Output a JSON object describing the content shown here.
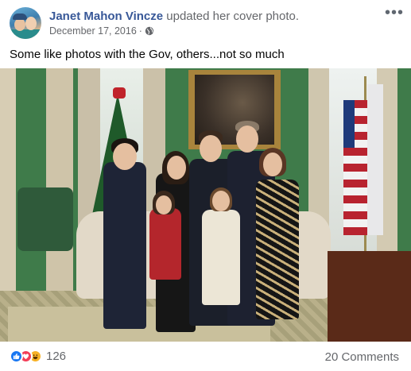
{
  "post": {
    "author": "Janet Mahon Vincze",
    "action": " updated her cover photo.",
    "date": "December 17, 2016",
    "dot": "·",
    "privacy_icon": "globe-icon",
    "more_label": "•••",
    "text": "Some like photos with the Gov, others...not so much"
  },
  "footer": {
    "reaction_icons": [
      "like-icon",
      "love-icon",
      "haha-icon"
    ],
    "reaction_count": "126",
    "comments_label": "20 Comments"
  },
  "colors": {
    "author_link": "#385898",
    "secondary_text": "#65676b",
    "like_blue": "#1877f2",
    "love_red": "#f33e58",
    "haha_yellow": "#f7b125"
  }
}
